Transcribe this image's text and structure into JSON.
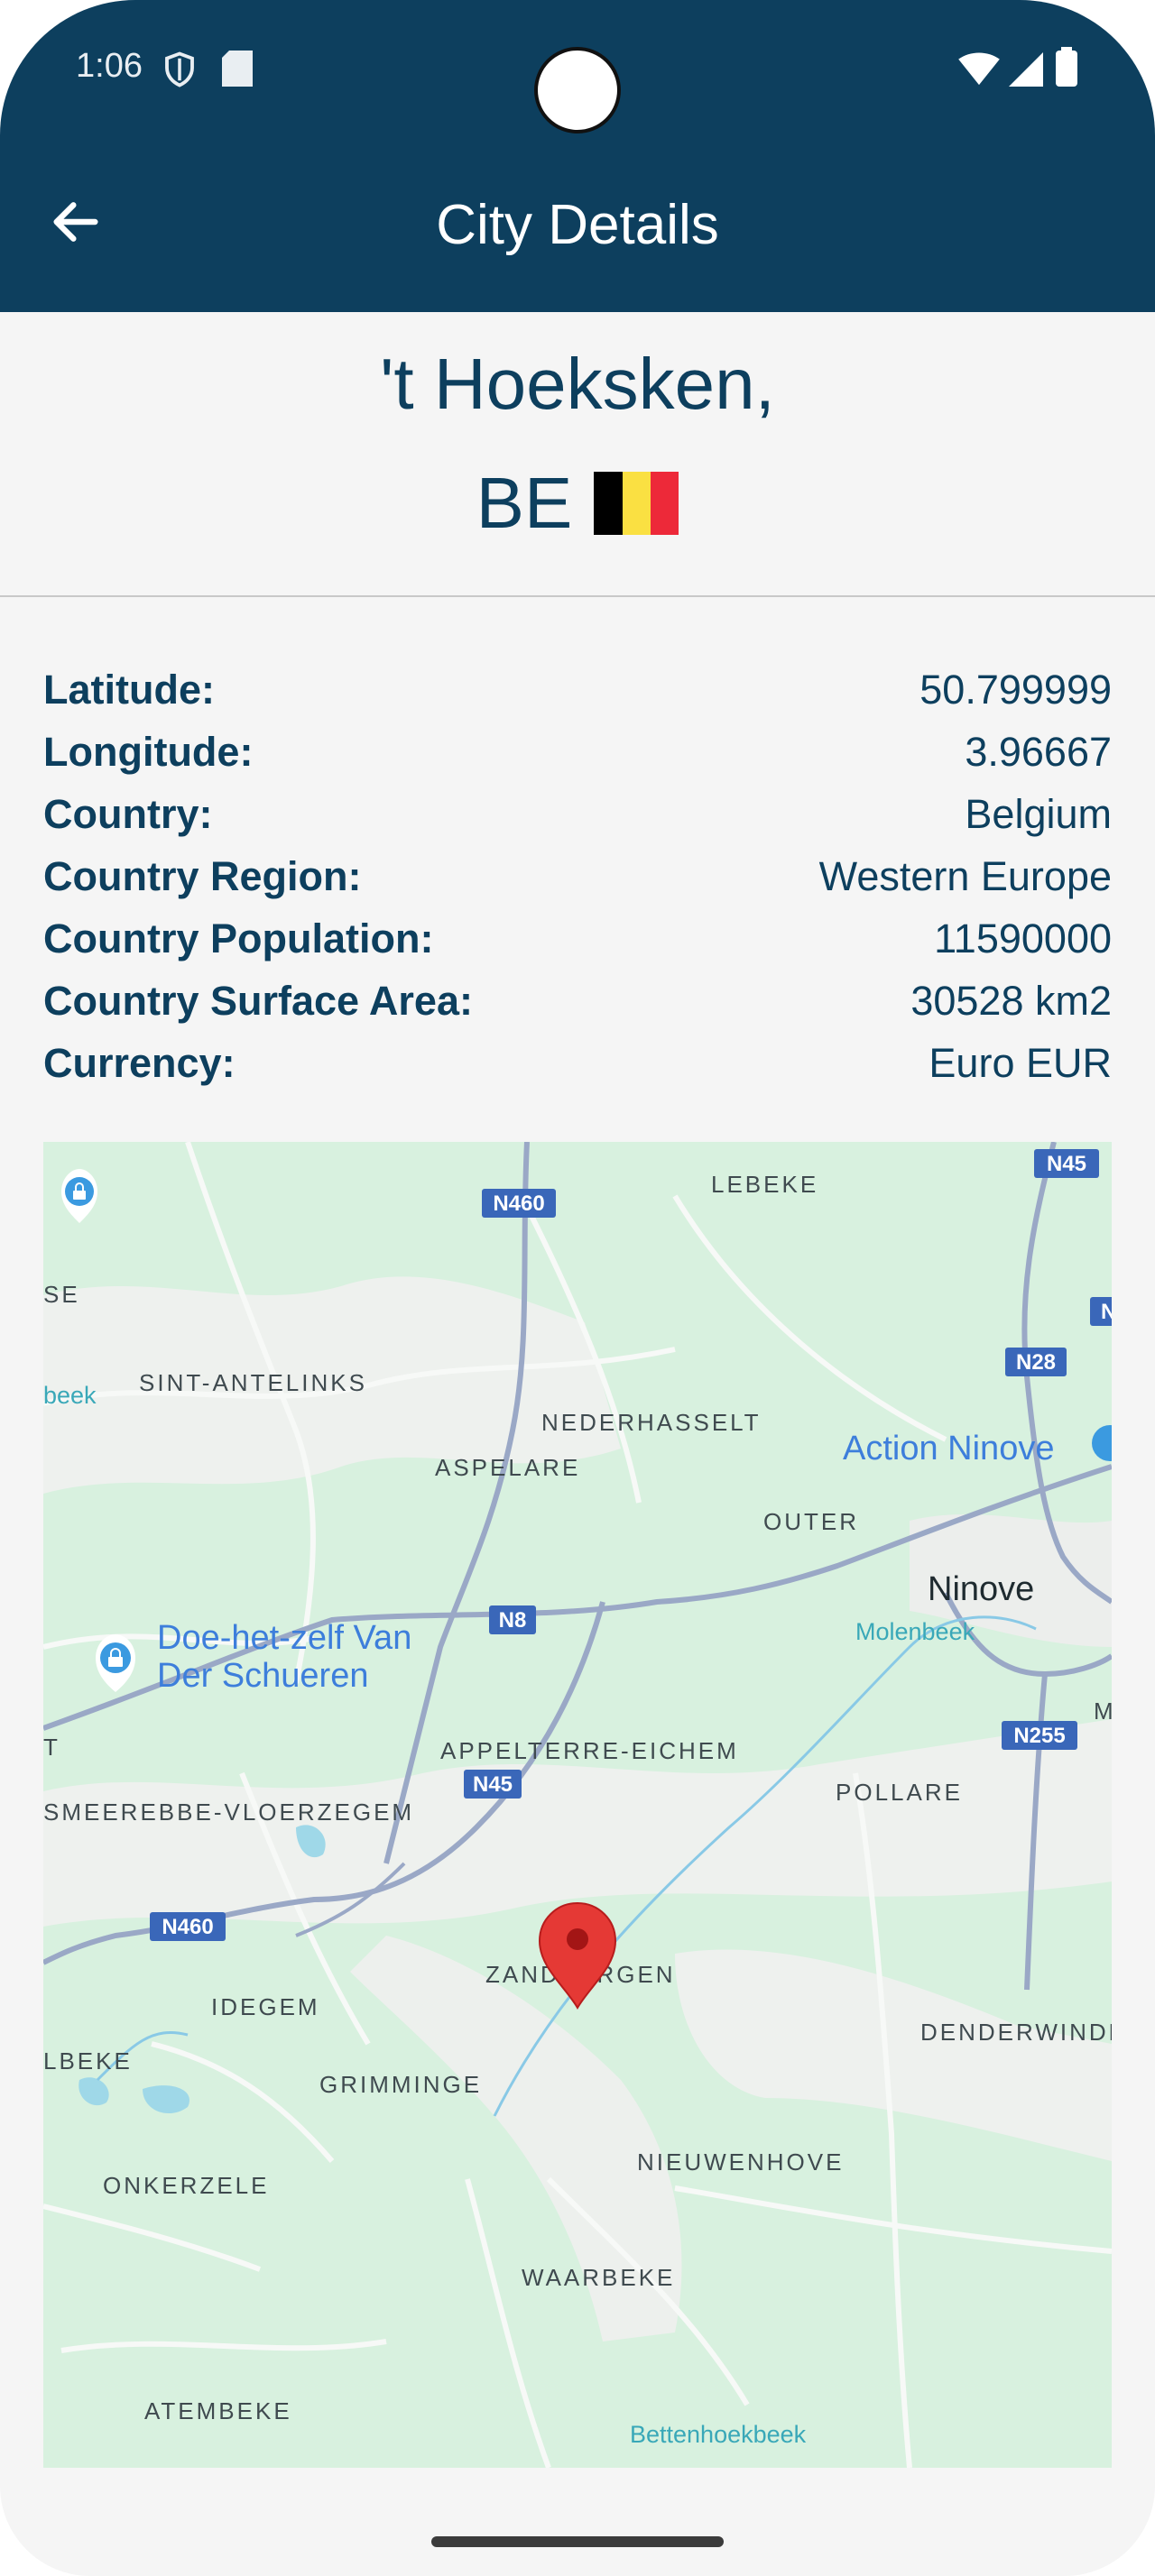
{
  "status_bar": {
    "time": "1:06"
  },
  "header": {
    "title": "City Details"
  },
  "city": {
    "name": "'t Hoeksken,",
    "country_code": "BE",
    "flag_colors": [
      "#000000",
      "#FAE042",
      "#ED2939"
    ]
  },
  "details": [
    {
      "label": "Latitude:",
      "value": "50.799999"
    },
    {
      "label": "Longitude:",
      "value": "3.96667"
    },
    {
      "label": "Country:",
      "value": "Belgium"
    },
    {
      "label": "Country Region:",
      "value": "Western Europe"
    },
    {
      "label": "Country Population:",
      "value": "11590000"
    },
    {
      "label": "Country Surface Area:",
      "value": "30528 km2"
    },
    {
      "label": "Currency:",
      "value": "Euro EUR"
    }
  ],
  "map": {
    "places": {
      "lebeke": "LEBEKE",
      "sint_antelinks": "SINT-ANTELINKS",
      "nederhasselt": "NEDERHASSELT",
      "aspelare": "ASPELARE",
      "outer": "OUTER",
      "ninove": "Ninove",
      "appelterre": "APPELTERRE-EICHEM",
      "smeerebbe": "SMEEREBBE-VLOERZEGEM",
      "pollare": "POLLARE",
      "zandbergen": "ZANDBERGEN",
      "idegem": "IDEGEM",
      "denderwindeke": "DENDERWINDE",
      "grimminge": "GRIMMINGE",
      "nieuwenhove": "NIEUWENHOVE",
      "onkerzele": "ONKERZELE",
      "waarbeke": "WAARBEKE",
      "atembeke": "ATEMBEKE",
      "lbeke": "LBEKE",
      "se_edge": "SE",
      "t_edge": "T",
      "m_edge": "M"
    },
    "pois": {
      "action": "Action Ninove",
      "doe_line1": "Doe-het-zelf Van",
      "doe_line2": "Der Schueren"
    },
    "water": {
      "molenbeek": "Molenbeek",
      "bettenhoekbeek": "Bettenhoekbeek",
      "beek_edge": "beek"
    },
    "roads": {
      "n460_top": "N460",
      "n45_top": "N45",
      "n28": "N28",
      "n8": "N8",
      "n45_mid": "N45",
      "n255": "N255",
      "n460_bottom": "N460",
      "n_edge": "N"
    }
  }
}
